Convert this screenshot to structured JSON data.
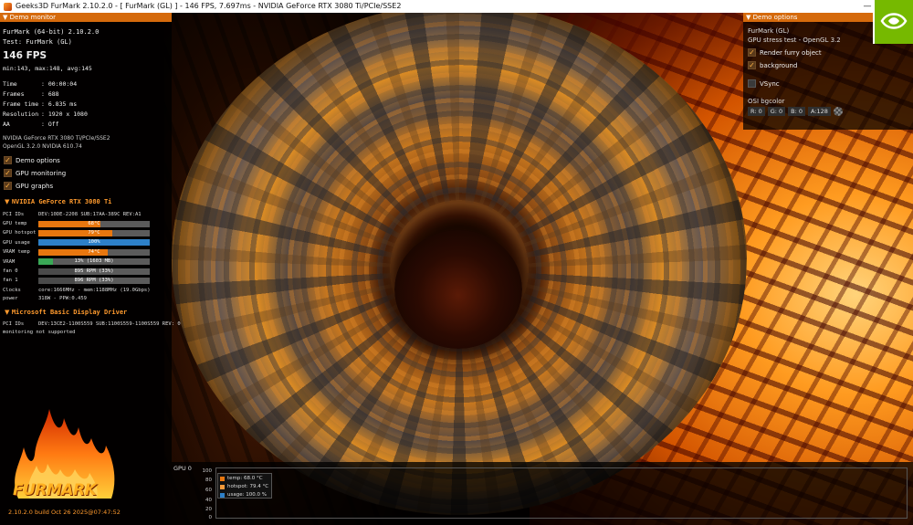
{
  "window": {
    "title": "Geeks3D FurMark 2.10.2.0 - [ FurMark (GL) ] - 146 FPS, 7.697ms - NVIDIA GeForce RTX 3080 Ti/PCIe/SSE2"
  },
  "left_panel": {
    "header": "Demo monitor",
    "app_line": "FurMark (64-bit) 2.10.2.0",
    "test_line": "Test: FurMark (GL)",
    "fps": "146 FPS",
    "fps_stats": "min:143, max:148, avg:145",
    "stats": [
      {
        "key": "Time",
        "value": ": 00:00:04"
      },
      {
        "key": "Frames",
        "value": ": 688"
      },
      {
        "key": "Frame time",
        "value": ": 6.835 ms"
      },
      {
        "key": "Resolution",
        "value": ": 1920 x 1080"
      },
      {
        "key": "AA",
        "value": ": Off"
      }
    ],
    "renderer": "NVIDIA GeForce RTX 3080 Ti/PCIe/SSE2",
    "opengl": "OpenGL 3.2.0 NVIDIA 610.74",
    "options": [
      {
        "label": "Demo options",
        "checked": true
      },
      {
        "label": "GPU monitoring",
        "checked": true
      },
      {
        "label": "GPU graphs",
        "checked": true
      }
    ],
    "gpu_section": {
      "title": "NVIDIA GeForce RTX 3080 Ti",
      "pci_label": "PCI IDs",
      "pci_value": "DEV:10DE-2208 SUB:17AA-389C REV:A1",
      "bars": [
        {
          "label": "GPU temp",
          "text": "68°C",
          "fraction": 0.56,
          "color": "#e8770f"
        },
        {
          "label": "GPU hotspot",
          "text": "79°C",
          "fraction": 0.66,
          "color": "#e8770f"
        },
        {
          "label": "GPU usage",
          "text": "100%",
          "fraction": 1.0,
          "color": "#2d80c8"
        },
        {
          "label": "VRAM temp",
          "text": "74°C",
          "fraction": 0.62,
          "color": "#e8770f"
        },
        {
          "label": "VRAM",
          "text": "13% (1603 MB)",
          "fraction": 0.13,
          "color": "#3aa856"
        },
        {
          "label": "fan 0",
          "text": "895 RPM (33%)",
          "fraction": 0.33,
          "color": "#4a4a4a"
        },
        {
          "label": "fan 1",
          "text": "896 RPM (33%)",
          "fraction": 0.33,
          "color": "#4a4a4a"
        }
      ],
      "clocks_label": "Clocks",
      "clocks_value": "core:1666MHz - mem:1188MHz (19.0Gbps)",
      "power_label": "power",
      "power_value": "318W - PPW:0.459"
    },
    "display_section": {
      "title": "Microsoft Basic Display Driver",
      "pci_label": "PCI IDs",
      "pci_value": "DEV:13CE2-1100S559 SUB:1100S559-1100S559 REV: 0",
      "note": "monitoring not supported"
    },
    "logo_text": "FURMARK",
    "build": "2.10.2.0 build Oct 26 2025@07:47:52"
  },
  "right_panel": {
    "header": "Demo options",
    "demo_name": "FurMark (GL)",
    "demo_desc": "GPU stress test - OpenGL 3.2",
    "options": [
      {
        "label": "Render furry object",
        "checked": true
      },
      {
        "label": "background",
        "checked": true
      }
    ],
    "vsync": {
      "label": "VSync",
      "checked": false
    },
    "bgcolor_label": "OSI bgcolor",
    "channels": [
      "R: 0",
      "G: 0",
      "B: 0",
      "A:128"
    ]
  },
  "graph": {
    "title": "GPU 0",
    "y_ticks": [
      "100",
      "80",
      "60",
      "40",
      "20",
      "0"
    ],
    "legend": [
      {
        "label": "temp: 68.0 °C",
        "color": "#e8770f"
      },
      {
        "label": "hotspot: 79.4 °C",
        "color": "#f39a3a"
      },
      {
        "label": "usage: 100.0 %",
        "color": "#2d80c8"
      }
    ]
  },
  "icons": {
    "app": "furmark-app-icon",
    "minimize": "minimize-icon",
    "maximize": "maximize-icon",
    "close": "close-icon",
    "brand": "nvidia-logo"
  }
}
